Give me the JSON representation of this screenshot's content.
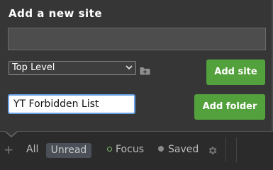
{
  "popup": {
    "title": "Add a new site",
    "site_url": {
      "value": "",
      "placeholder": ""
    },
    "folder_select": {
      "selected": "Top Level"
    },
    "add_site_label": "Add site",
    "folder_name": {
      "value": "YT Forbidden List"
    },
    "add_folder_label": "Add folder"
  },
  "bottom_bar": {
    "plus": "+",
    "all_label": "All",
    "unread_label": "Unread",
    "focus_label": "Focus",
    "saved_label": "Saved"
  },
  "icons": {
    "select_chevron": "chevron-down-icon",
    "new_folder": "folder-plus-icon",
    "settings": "gear-icon"
  },
  "colors": {
    "accent_green": "#53a13c",
    "focus_ring": "#69a2e6",
    "popup_bg": "#363636",
    "bar_bg": "#2b2b2c"
  }
}
